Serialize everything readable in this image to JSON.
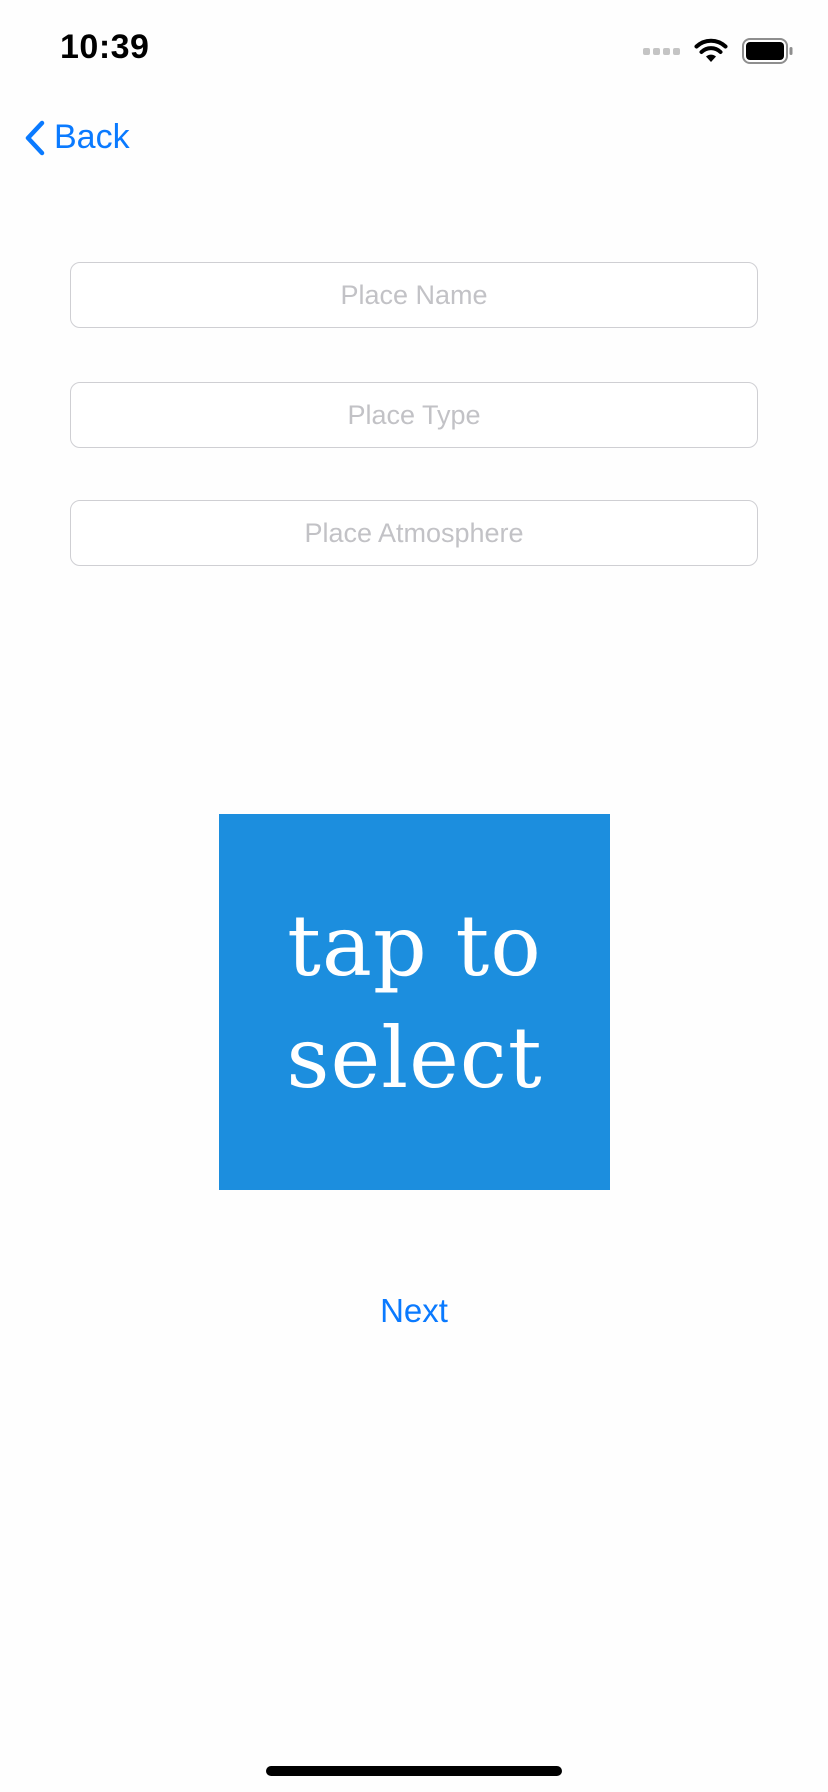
{
  "status_bar": {
    "time": "10:39",
    "icons": [
      "cellular-signal-icon",
      "wifi-icon",
      "battery-icon"
    ]
  },
  "nav": {
    "back_label": "Back",
    "back_icon": "chevron-left-icon"
  },
  "form": {
    "place_name": {
      "value": "",
      "placeholder": "Place Name"
    },
    "place_type": {
      "value": "",
      "placeholder": "Place Type"
    },
    "place_atmosphere": {
      "value": "",
      "placeholder": "Place Atmosphere"
    }
  },
  "image_select": {
    "label": "tap to select",
    "background_color": "#1c8ede"
  },
  "actions": {
    "next_label": "Next"
  },
  "colors": {
    "accent": "#0a7aff",
    "placeholder": "#c2c2c6",
    "field_border": "#cfcfd3"
  }
}
